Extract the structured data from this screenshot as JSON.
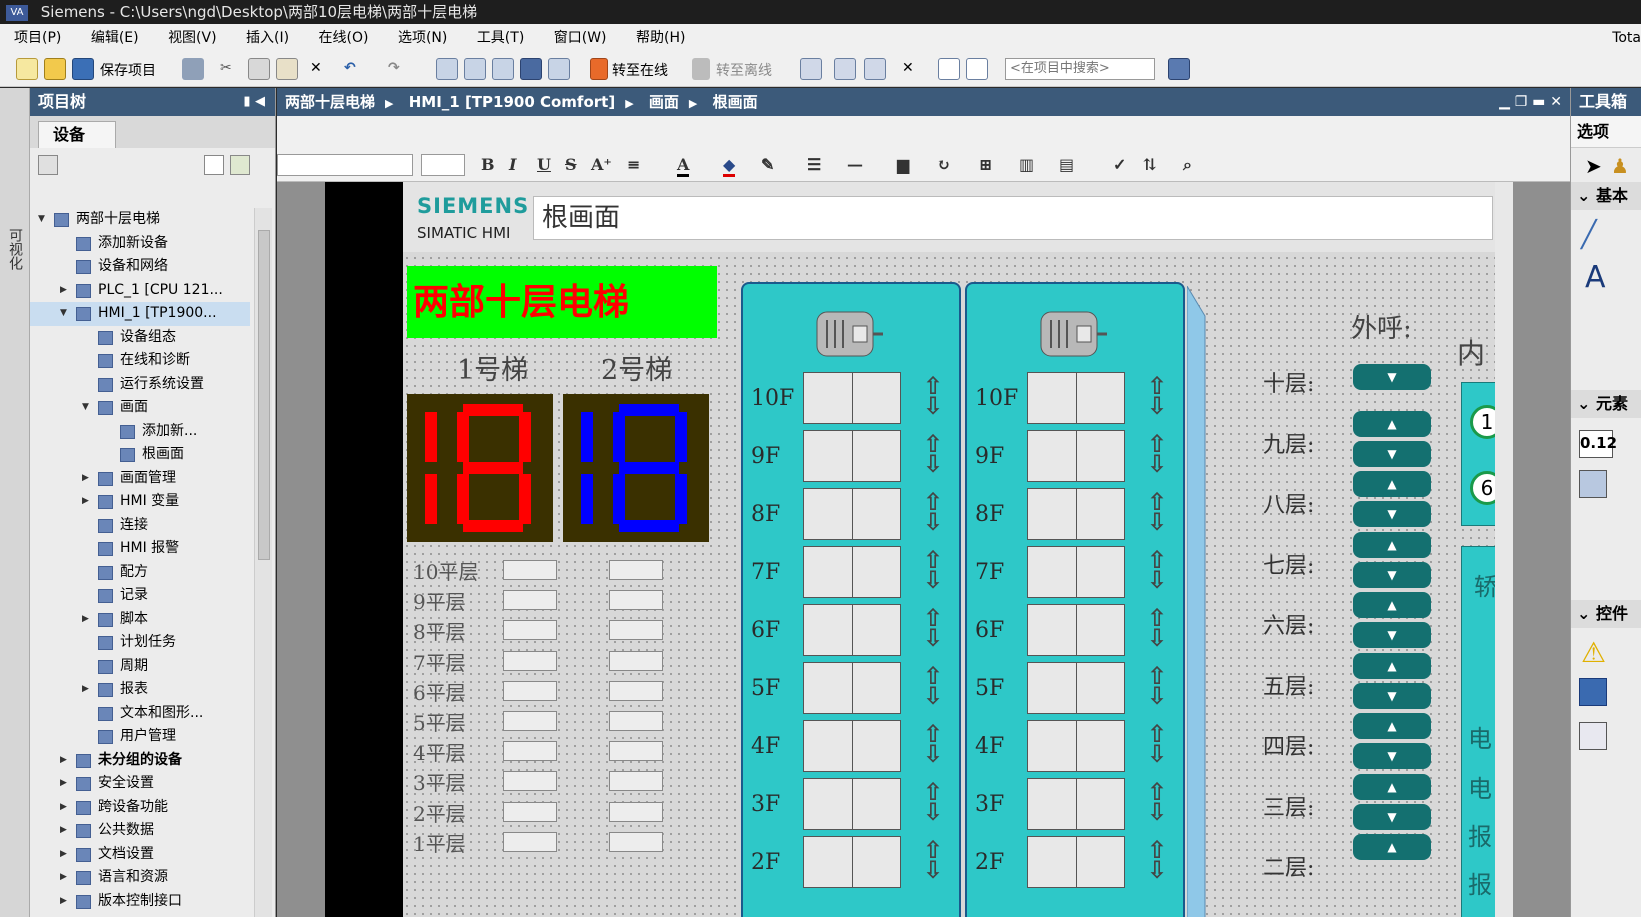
{
  "window": {
    "app_icon": "VA",
    "title": "Siemens  -  C:\\Users\\ngd\\Desktop\\两部10层电梯\\两部十层电梯"
  },
  "menu": {
    "items": [
      "项目(P)",
      "编辑(E)",
      "视图(V)",
      "插入(I)",
      "在线(O)",
      "选项(N)",
      "工具(T)",
      "窗口(W)",
      "帮助(H)"
    ],
    "right_text": "Tota"
  },
  "toolbar": {
    "save_label": "保存项目",
    "go_online_label": "转至在线",
    "go_offline_label": "转至离线",
    "search_placeholder": "<在项目中搜索>"
  },
  "left_strip": {
    "label": "可视化"
  },
  "project_tree": {
    "title": "项目树",
    "tab": "设备",
    "nodes": [
      {
        "label": "两部十层电梯",
        "level": 0,
        "arrow": "open",
        "icon": "project-icon"
      },
      {
        "label": "添加新设备",
        "level": 1,
        "arrow": "",
        "icon": "add-device-icon"
      },
      {
        "label": "设备和网络",
        "level": 1,
        "arrow": "",
        "icon": "network-icon"
      },
      {
        "label": "PLC_1 [CPU 121...",
        "level": 1,
        "arrow": "closed",
        "icon": "plc-icon"
      },
      {
        "label": "HMI_1 [TP1900...",
        "level": 1,
        "arrow": "open",
        "icon": "hmi-icon",
        "selected": true
      },
      {
        "label": "设备组态",
        "level": 2,
        "arrow": "",
        "icon": "device-config-icon"
      },
      {
        "label": "在线和诊断",
        "level": 2,
        "arrow": "",
        "icon": "diagnostics-icon"
      },
      {
        "label": "运行系统设置",
        "level": 2,
        "arrow": "",
        "icon": "runtime-settings-icon"
      },
      {
        "label": "画面",
        "level": 2,
        "arrow": "open",
        "icon": "folder-icon"
      },
      {
        "label": "添加新...",
        "level": 3,
        "arrow": "",
        "icon": "add-screen-icon"
      },
      {
        "label": "根画面",
        "level": 3,
        "arrow": "",
        "icon": "screen-icon"
      },
      {
        "label": "画面管理",
        "level": 2,
        "arrow": "closed",
        "icon": "folder-icon"
      },
      {
        "label": "HMI 变量",
        "level": 2,
        "arrow": "closed",
        "icon": "folder-icon"
      },
      {
        "label": "连接",
        "level": 2,
        "arrow": "",
        "icon": "connection-icon"
      },
      {
        "label": "HMI 报警",
        "level": 2,
        "arrow": "",
        "icon": "alarm-icon"
      },
      {
        "label": "配方",
        "level": 2,
        "arrow": "",
        "icon": "recipe-icon"
      },
      {
        "label": "记录",
        "level": 2,
        "arrow": "",
        "icon": "log-icon"
      },
      {
        "label": "脚本",
        "level": 2,
        "arrow": "closed",
        "icon": "folder-icon"
      },
      {
        "label": "计划任务",
        "level": 2,
        "arrow": "",
        "icon": "scheduler-icon"
      },
      {
        "label": "周期",
        "level": 2,
        "arrow": "",
        "icon": "cycle-icon"
      },
      {
        "label": "报表",
        "level": 2,
        "arrow": "closed",
        "icon": "folder-icon"
      },
      {
        "label": "文本和图形...",
        "level": 2,
        "arrow": "",
        "icon": "text-graphics-icon"
      },
      {
        "label": "用户管理",
        "level": 2,
        "arrow": "",
        "icon": "user-admin-icon"
      },
      {
        "label": "未分组的设备",
        "level": 1,
        "arrow": "closed",
        "icon": "folder-icon",
        "bold": true
      },
      {
        "label": "安全设置",
        "level": 1,
        "arrow": "closed",
        "icon": "security-icon"
      },
      {
        "label": "跨设备功能",
        "level": 1,
        "arrow": "closed",
        "icon": "cross-device-icon"
      },
      {
        "label": "公共数据",
        "level": 1,
        "arrow": "closed",
        "icon": "common-data-icon"
      },
      {
        "label": "文档设置",
        "level": 1,
        "arrow": "closed",
        "icon": "doc-settings-icon"
      },
      {
        "label": "语言和资源",
        "level": 1,
        "arrow": "closed",
        "icon": "language-icon"
      },
      {
        "label": "版本控制接口",
        "level": 1,
        "arrow": "closed",
        "icon": "version-control-icon"
      }
    ]
  },
  "breadcrumb": {
    "items": [
      "两部十层电梯",
      "HMI_1 [TP1900 Comfort]",
      "画面",
      "根画面"
    ]
  },
  "hmi": {
    "brand": "SIEMENS",
    "product": "SIMATIC HMI",
    "screen_title": "根画面",
    "main_title": "两部十层电梯",
    "elevator1_label": "1号梯",
    "elevator2_label": "2号梯",
    "floor_rows": [
      "10平层",
      "9平层",
      "8平层",
      "7平层",
      "6平层",
      "5平层",
      "4平层",
      "3平层",
      "2平层",
      "1平层"
    ],
    "shaft_floors": [
      "10F",
      "9F",
      "8F",
      "7F",
      "6F",
      "5F",
      "4F",
      "3F",
      "2F"
    ],
    "outside_call_label": "外呼:",
    "call_floors": [
      "十层:",
      "九层:",
      "八层:",
      "七层:",
      "六层:",
      "五层:",
      "四层:",
      "三层:",
      "二层:"
    ],
    "inner_label": "内",
    "inner_values": [
      "1",
      "6"
    ],
    "inner_chars": [
      "轿",
      "电",
      "电",
      "报",
      "报"
    ]
  },
  "toolbox": {
    "title": "工具箱",
    "options_label": "选项",
    "sections": [
      "基本",
      "元素",
      "控件"
    ],
    "element_text": "0.12"
  },
  "colors": {
    "header_bg": "#3c5a7a",
    "title_green": "#00ff00",
    "title_red": "#ff0000",
    "shaft_cyan": "#2ec8c8",
    "call_button": "#147070",
    "seg_red": "#ff0000",
    "seg_blue": "#0000ff",
    "seg_bg": "#3a3000"
  }
}
